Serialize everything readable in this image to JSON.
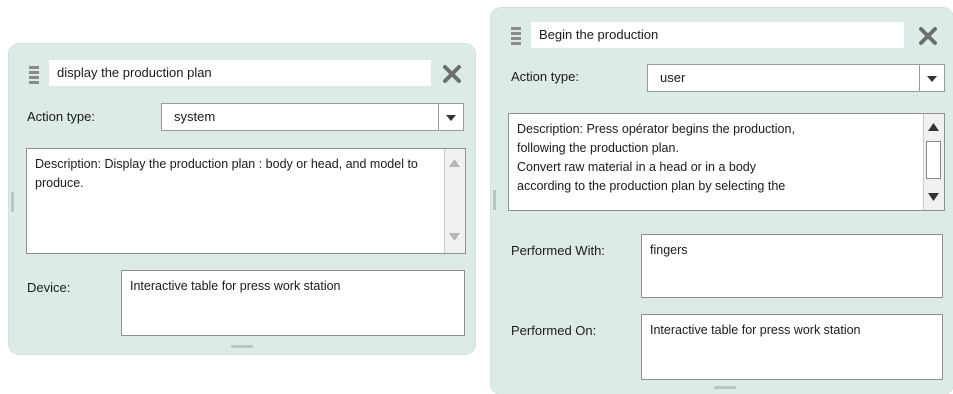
{
  "left_card": {
    "title": "display the production plan",
    "action_type_label": "Action type:",
    "action_type_value": "system",
    "description": "Description: Display the production plan : body or head, and model to produce.",
    "device_label": "Device:",
    "device_value": "Interactive table for press work station"
  },
  "right_card": {
    "title": "Begin the production",
    "action_type_label": "Action type:",
    "action_type_value": "user",
    "description_lines": [
      "Description: Press opérator begins the production,",
      "following the production plan.",
      "Convert raw material in a head or in a body",
      "according to the production plan by selecting the"
    ],
    "performed_with_label": "Performed With:",
    "performed_with_value": "fingers",
    "performed_on_label": "Performed On:",
    "performed_on_value": "Interactive table for press work station"
  },
  "colors": {
    "card_background": "#dcebe6",
    "field_border": "#8f8f8f",
    "icon_gray": "#7a7a7a"
  }
}
